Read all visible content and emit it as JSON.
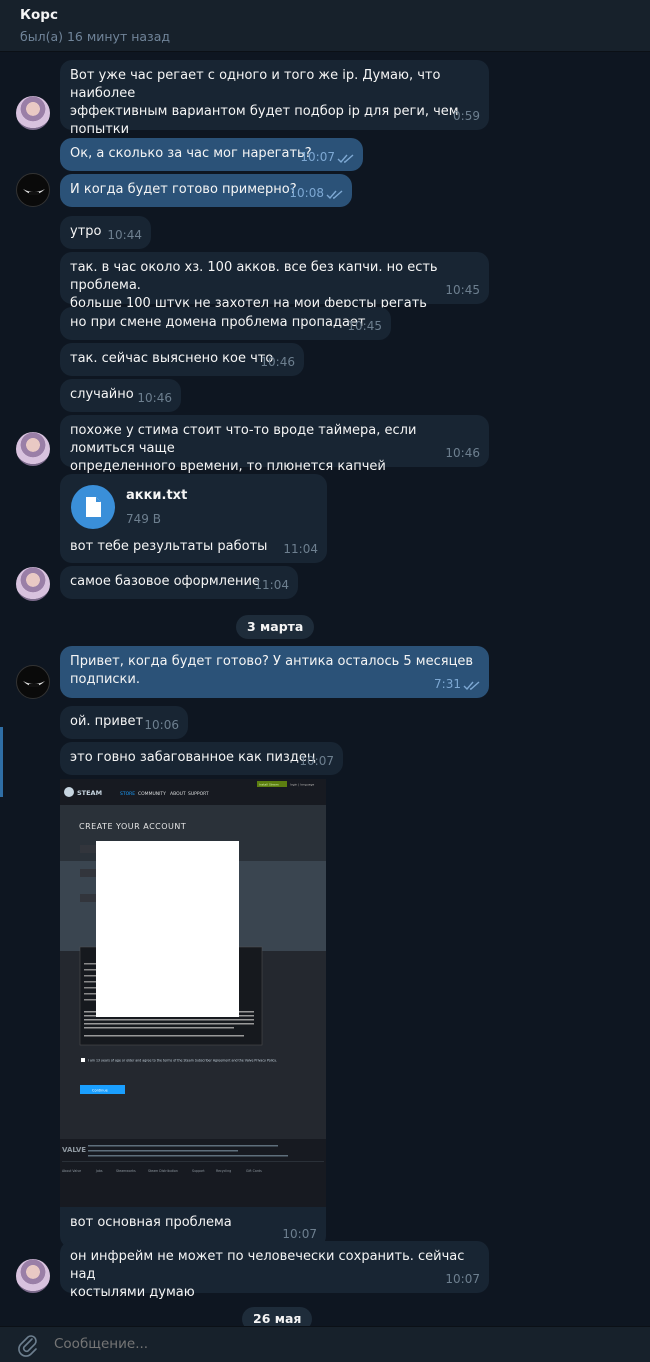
{
  "header": {
    "title": "Корс",
    "status": "был(а) 16 минут назад"
  },
  "messages": [
    {
      "text": "Вот уже час регает с одного и того же ip. Думаю, что наиболее\nэффективным вариантом будет подбор ip для реги, чем попытки\nпробить капчу",
      "time": "0:59"
    },
    {
      "text": "Ок, а сколько за час мог нарегать?",
      "time": "10:07"
    },
    {
      "text": "И когда будет готово примерно?",
      "time": "10:08"
    },
    {
      "text": "утро",
      "time": "10:44"
    },
    {
      "text": "так. в час около хз. 100 акков. все без капчи. но есть проблема.\nбольше 100 штук не захотел на мои ферсты регать",
      "time": "10:45"
    },
    {
      "text": "но при смене домена проблема пропадает",
      "time": "10:45"
    },
    {
      "text": "так. сейчас выяснено кое что",
      "time": "10:46"
    },
    {
      "text": "случайно",
      "time": "10:46"
    },
    {
      "text": "похоже у стима стоит что-то вроде таймера, если ломиться чаще\nопределенного времени, то плюнется капчей",
      "time": "10:46"
    },
    {
      "text": "вот тебе результаты работы",
      "time": "11:04"
    },
    {
      "text": "самое базовое оформление",
      "time": "11:04"
    },
    {
      "text": "Привет, когда будет готово? У антика осталось 5 месяцев\nподписки.",
      "time": "7:31"
    },
    {
      "text": "ой. привет",
      "time": "10:06"
    },
    {
      "text": "это говно забагованное как пиздец",
      "time": "10:07"
    },
    {
      "text": "вот основная проблема",
      "time": "10:07"
    },
    {
      "text": "он инфрейм не может по человечески сохранить. сейчас над\nкостылями думаю",
      "time": "10:07"
    }
  ],
  "file": {
    "name": "акки.txt",
    "size": "749 B"
  },
  "dates": [
    "3 марта",
    "26 мая"
  ],
  "screenshot": {
    "steam_nav": [
      "STORE",
      "COMMUNITY",
      "ABOUT",
      "SUPPORT"
    ],
    "steam_logo": "STEAM",
    "install_button": "Install Steam",
    "top_links": "login | language",
    "heading": "CREATE YOUR ACCOUNT",
    "checkbox_label": "I am 13 years of age or older and agree to the terms of the Steam Subscriber Agreement and the Valve Privacy Policy.",
    "continue_label": "Continue",
    "footer_brand": "VALVE",
    "footer_links": [
      "About Valve",
      "Jobs",
      "Steamworks",
      "Steam Distribution",
      "Support",
      "Recycling",
      "Gift Cards"
    ]
  },
  "composer": {
    "placeholder": "Сообщение..."
  },
  "colors": {
    "bg": "#0e1621",
    "in": "#182533",
    "out": "#2b5278",
    "accent": "#3a8fd9"
  }
}
